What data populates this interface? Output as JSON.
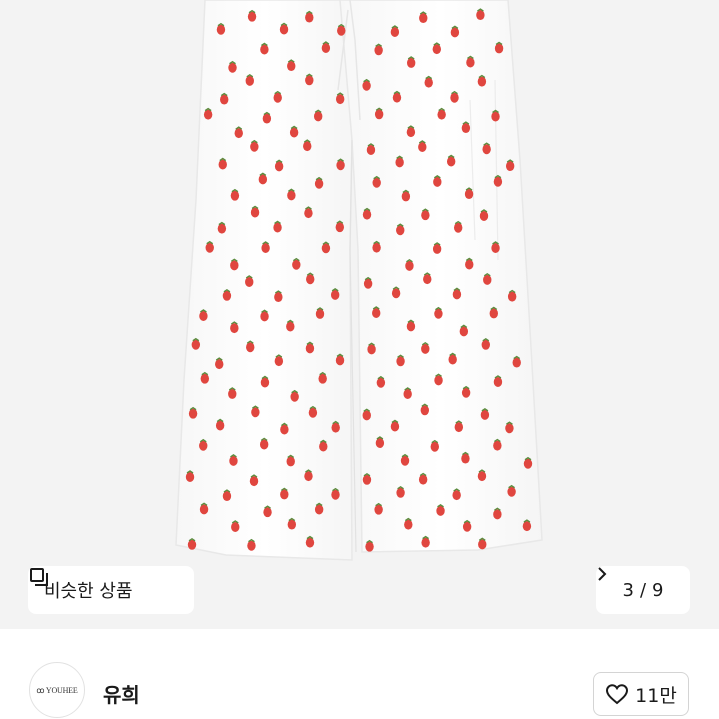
{
  "product_image": {
    "description_icon": "image",
    "background_color": "#f3f3f3",
    "fabric_color": "#fdfdfd",
    "print_color": "#e0463f"
  },
  "similar_button": {
    "label": "비슷한 상품",
    "icon": "copy-icon"
  },
  "pager": {
    "current": "3",
    "separator": "/",
    "total": "9",
    "icon": "chevron-right-icon"
  },
  "seller": {
    "name": "유희",
    "avatar_text": "ꝏ YOUHEE",
    "avatar_icon": "avatar-logo"
  },
  "like_button": {
    "count": "11만",
    "icon": "heart-icon"
  }
}
